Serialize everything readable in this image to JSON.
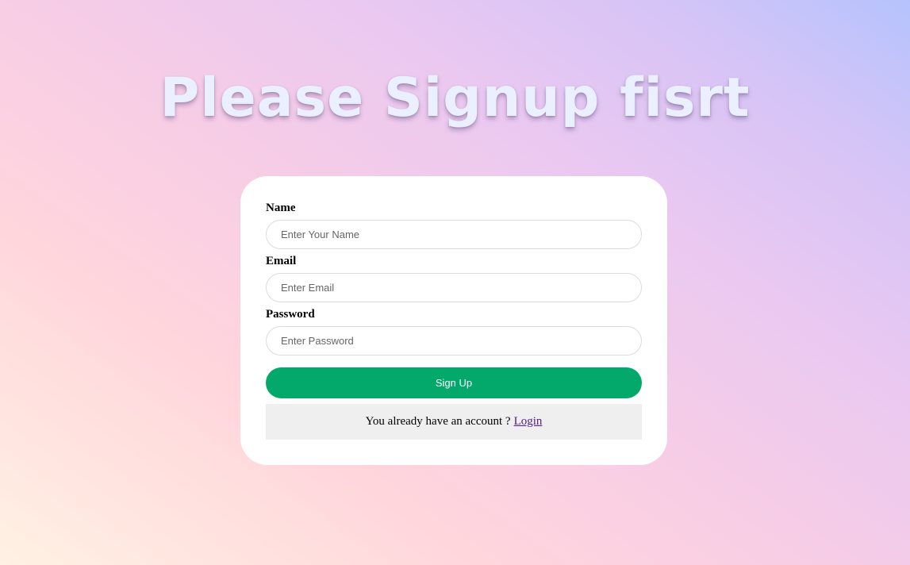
{
  "page": {
    "title": "Please Signup fisrt"
  },
  "form": {
    "name_label": "Name",
    "name_placeholder": "Enter Your Name",
    "name_value": "",
    "email_label": "Email",
    "email_placeholder": "Enter Email",
    "email_value": "",
    "password_label": "Password",
    "password_placeholder": "Enter Password",
    "password_value": "",
    "submit_label": "Sign Up",
    "login_prompt": "You already have an account ?",
    "login_link": "Login"
  },
  "colors": {
    "button": "#03a86b",
    "title_text": "#eaf0ff",
    "link": "#551a8b",
    "login_box_bg": "#efefef"
  }
}
